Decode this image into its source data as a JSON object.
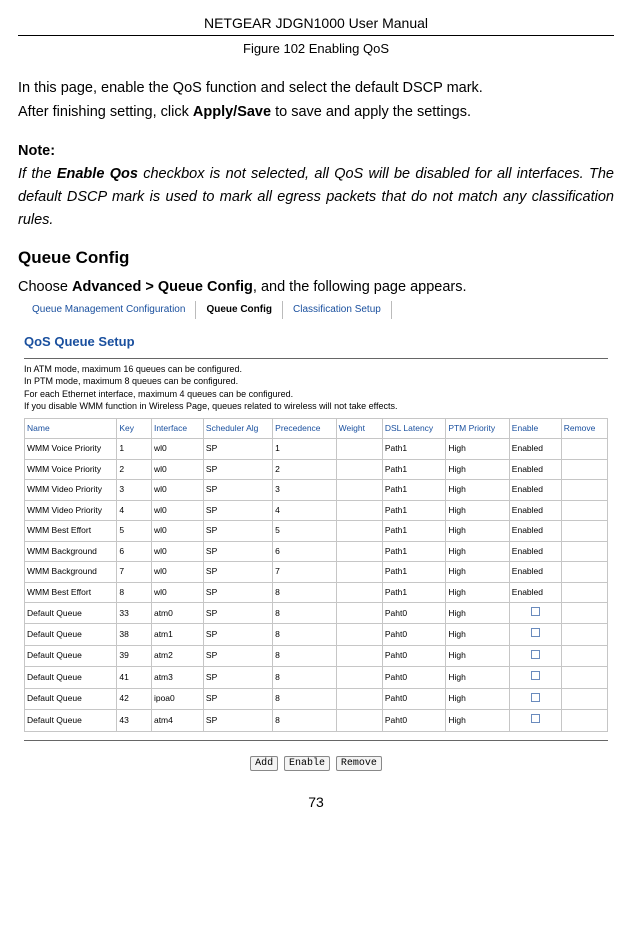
{
  "header": {
    "title": "NETGEAR JDGN1000 User Manual"
  },
  "caption": "Figure 102 Enabling QoS",
  "intro": {
    "line1": "In this page, enable the QoS function and select the default DSCP mark.",
    "line2a": "After finishing setting, click ",
    "line2b": "Apply/Save",
    "line2c": " to save and apply the settings."
  },
  "note": {
    "label": "Note:",
    "a": "If the ",
    "b": "Enable Qos",
    "c": " checkbox is not selected, all QoS will be disabled for all interfaces. The default DSCP mark is used to mark all egress packets that do not match any classification rules."
  },
  "section": "Queue Config",
  "section_intro": {
    "a": "Choose ",
    "b": "Advanced > Queue Config",
    "c": ", and the following page appears."
  },
  "shot": {
    "tabs": [
      "Queue Management Configuration",
      "Queue Config",
      "Classification Setup"
    ],
    "active_tab": 1,
    "title": "QoS Queue Setup",
    "note_lines": [
      "In ATM mode, maximum 16 queues can be configured.",
      "In PTM mode, maximum 8 queues can be configured.",
      "For each Ethernet interface, maximum 4 queues can be configured.",
      "If you disable WMM function in Wireless Page, queues related to wireless will not take effects."
    ],
    "note_bold": "16",
    "columns": [
      "Name",
      "Key",
      "Interface",
      "Scheduler Alg",
      "Precedence",
      "Weight",
      "DSL Latency",
      "PTM Priority",
      "Enable",
      "Remove"
    ],
    "rows": [
      {
        "name": "WMM Voice Priority",
        "key": "1",
        "iface": "wl0",
        "alg": "SP",
        "prec": "1",
        "wt": "",
        "lat": "Path1",
        "pri": "High",
        "enable": "Enabled",
        "remove": ""
      },
      {
        "name": "WMM Voice Priority",
        "key": "2",
        "iface": "wl0",
        "alg": "SP",
        "prec": "2",
        "wt": "",
        "lat": "Path1",
        "pri": "High",
        "enable": "Enabled",
        "remove": ""
      },
      {
        "name": "WMM Video Priority",
        "key": "3",
        "iface": "wl0",
        "alg": "SP",
        "prec": "3",
        "wt": "",
        "lat": "Path1",
        "pri": "High",
        "enable": "Enabled",
        "remove": ""
      },
      {
        "name": "WMM Video Priority",
        "key": "4",
        "iface": "wl0",
        "alg": "SP",
        "prec": "4",
        "wt": "",
        "lat": "Path1",
        "pri": "High",
        "enable": "Enabled",
        "remove": ""
      },
      {
        "name": "WMM Best Effort",
        "key": "5",
        "iface": "wl0",
        "alg": "SP",
        "prec": "5",
        "wt": "",
        "lat": "Path1",
        "pri": "High",
        "enable": "Enabled",
        "remove": ""
      },
      {
        "name": "WMM Background",
        "key": "6",
        "iface": "wl0",
        "alg": "SP",
        "prec": "6",
        "wt": "",
        "lat": "Path1",
        "pri": "High",
        "enable": "Enabled",
        "remove": ""
      },
      {
        "name": "WMM Background",
        "key": "7",
        "iface": "wl0",
        "alg": "SP",
        "prec": "7",
        "wt": "",
        "lat": "Path1",
        "pri": "High",
        "enable": "Enabled",
        "remove": ""
      },
      {
        "name": "WMM Best Effort",
        "key": "8",
        "iface": "wl0",
        "alg": "SP",
        "prec": "8",
        "wt": "",
        "lat": "Path1",
        "pri": "High",
        "enable": "Enabled",
        "remove": ""
      },
      {
        "name": "Default Queue",
        "key": "33",
        "iface": "atm0",
        "alg": "SP",
        "prec": "8",
        "wt": "",
        "lat": "Paht0",
        "pri": "High",
        "enable": "[chk]",
        "remove": ""
      },
      {
        "name": "Default Queue",
        "key": "38",
        "iface": "atm1",
        "alg": "SP",
        "prec": "8",
        "wt": "",
        "lat": "Paht0",
        "pri": "High",
        "enable": "[chk]",
        "remove": ""
      },
      {
        "name": "Default Queue",
        "key": "39",
        "iface": "atm2",
        "alg": "SP",
        "prec": "8",
        "wt": "",
        "lat": "Paht0",
        "pri": "High",
        "enable": "[chk]",
        "remove": ""
      },
      {
        "name": "Default Queue",
        "key": "41",
        "iface": "atm3",
        "alg": "SP",
        "prec": "8",
        "wt": "",
        "lat": "Paht0",
        "pri": "High",
        "enable": "[chk]",
        "remove": ""
      },
      {
        "name": "Default Queue",
        "key": "42",
        "iface": "ipoa0",
        "alg": "SP",
        "prec": "8",
        "wt": "",
        "lat": "Paht0",
        "pri": "High",
        "enable": "[chk]",
        "remove": ""
      },
      {
        "name": "Default Queue",
        "key": "43",
        "iface": "atm4",
        "alg": "SP",
        "prec": "8",
        "wt": "",
        "lat": "Paht0",
        "pri": "High",
        "enable": "[chk]",
        "remove": ""
      }
    ],
    "buttons": {
      "add": "Add",
      "enable": "Enable",
      "remove": "Remove"
    }
  },
  "page_number": "73"
}
